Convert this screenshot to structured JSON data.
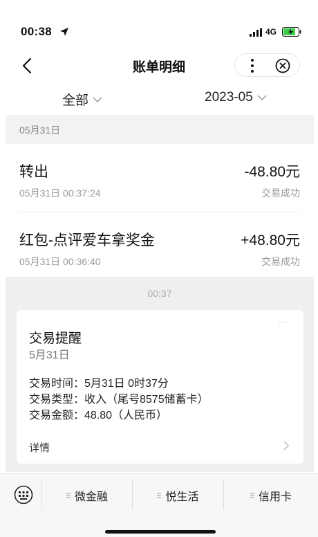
{
  "status_bar": {
    "time": "00:38",
    "network": "4G"
  },
  "nav": {
    "title": "账单明细"
  },
  "filter": {
    "category": "全部",
    "month": "2023-05"
  },
  "date_header": "05月31日",
  "transactions": [
    {
      "name": "转出",
      "amount": "-48.80元",
      "time": "05月31日 00:37:24",
      "status": "交易成功"
    },
    {
      "name": "红包-点评爱车拿奖金",
      "amount": "+48.80元",
      "time": "05月31日 00:36:40",
      "status": "交易成功"
    }
  ],
  "message": {
    "time": "00:37",
    "title": "交易提醒",
    "date": "5月31日",
    "lines": [
      "交易时间：5月31日 0时37分",
      "交易类型：收入（尾号8575储蓄卡）",
      "交易金额：48.80（人民币）"
    ],
    "detail_label": "详情"
  },
  "tabbar": {
    "items": [
      "微金融",
      "悦生活",
      "信用卡"
    ]
  },
  "colors": {
    "background": "#ffffff",
    "section_gray": "#f2f2f2",
    "battery_green": "#3dcc4a",
    "text_muted": "#999999"
  }
}
